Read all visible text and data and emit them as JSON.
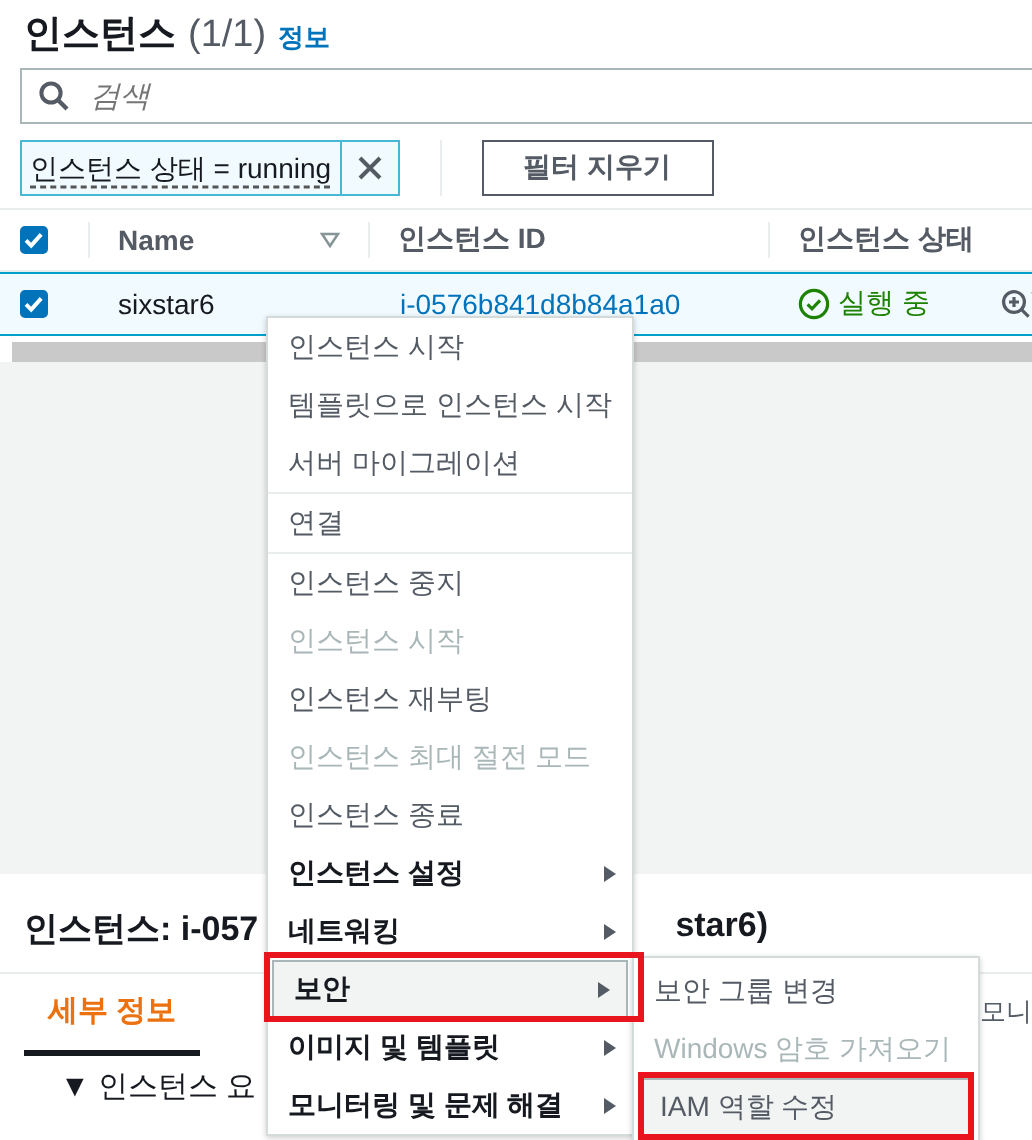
{
  "header": {
    "title": "인스턴스",
    "count": "(1/1)",
    "info_link": "정보"
  },
  "search": {
    "placeholder": "검색"
  },
  "filter": {
    "token": "인스턴스 상태 = running",
    "clear_button": "필터 지우기"
  },
  "table": {
    "select_all_checked": true,
    "columns": [
      "Name",
      "인스턴스 ID",
      "인스턴스 상태"
    ],
    "rows": [
      {
        "selected": true,
        "name": "sixstar6",
        "instance_id": "i-0576b841d8b84a1a0",
        "state": "실행 중"
      }
    ]
  },
  "details": {
    "title_start": "인스턴스: i-057",
    "title_end": "star6)",
    "tabs": [
      {
        "label": "세부 정보",
        "selected": true
      },
      {
        "label": "모니",
        "selected": false
      }
    ],
    "section": "▼ 인스턴스 요"
  },
  "context_menu": {
    "groups": [
      [
        {
          "label": "인스턴스 시작",
          "disabled": false,
          "submenu": false,
          "selected": false
        },
        {
          "label": "템플릿으로 인스턴스 시작",
          "disabled": false,
          "submenu": false,
          "selected": false
        },
        {
          "label": "서버 마이그레이션",
          "disabled": false,
          "submenu": false,
          "selected": false
        }
      ],
      [
        {
          "label": "연결",
          "disabled": false,
          "submenu": false,
          "selected": false
        }
      ],
      [
        {
          "label": "인스턴스 중지",
          "disabled": false,
          "submenu": false,
          "selected": false
        },
        {
          "label": "인스턴스 시작",
          "disabled": true,
          "submenu": false,
          "selected": false
        },
        {
          "label": "인스턴스 재부팅",
          "disabled": false,
          "submenu": false,
          "selected": false
        },
        {
          "label": "인스턴스 최대 절전 모드",
          "disabled": true,
          "submenu": false,
          "selected": false
        },
        {
          "label": "인스턴스 종료",
          "disabled": false,
          "submenu": false,
          "selected": false
        },
        {
          "label": "인스턴스 설정",
          "disabled": false,
          "submenu": true,
          "selected": false
        },
        {
          "label": "네트워킹",
          "disabled": false,
          "submenu": true,
          "selected": false
        },
        {
          "label": "보안",
          "disabled": false,
          "submenu": true,
          "selected": true
        },
        {
          "label": "이미지 및 템플릿",
          "disabled": false,
          "submenu": true,
          "selected": false
        },
        {
          "label": "모니터링 및 문제 해결",
          "disabled": false,
          "submenu": true,
          "selected": false
        }
      ]
    ]
  },
  "submenu": [
    {
      "label": "보안 그룹 변경",
      "disabled": false,
      "selected": false
    },
    {
      "label": "Windows 암호 가져오기",
      "disabled": true,
      "selected": false
    },
    {
      "label": "IAM 역할 수정",
      "disabled": false,
      "selected": true
    }
  ]
}
